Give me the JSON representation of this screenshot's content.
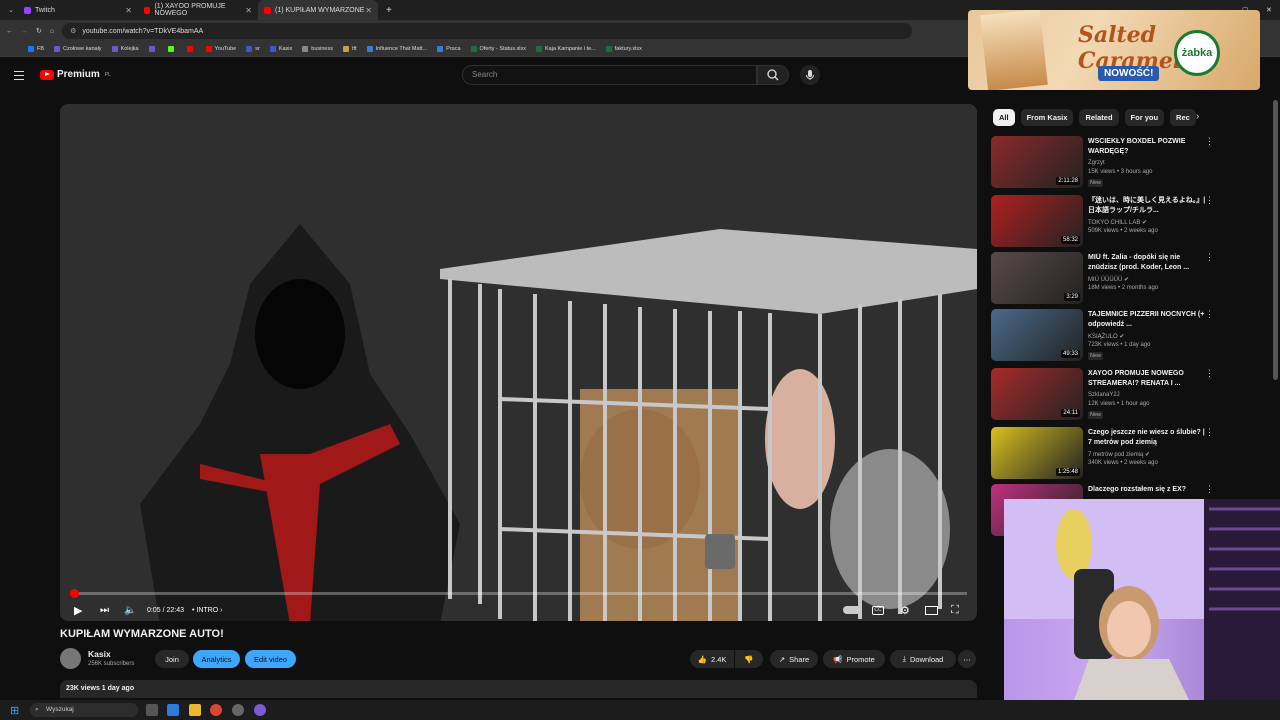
{
  "browser": {
    "tabs": [
      {
        "label": "Twitch",
        "color": "#9146ff"
      },
      {
        "label": "(1) XAYOO PROMUJE NOWEGO",
        "color": "#ff0000"
      },
      {
        "label": "(1) KUPIŁAM WYMARZONE",
        "color": "#ff0000",
        "active": true
      }
    ],
    "url": "youtube.com/watch?v=TDkVE4bamAA",
    "bookmarks": [
      {
        "label": "FB",
        "color": "#1877f2"
      },
      {
        "label": "Czołowe kanały",
        "color": "#6a5acd"
      },
      {
        "label": "Kolejka",
        "color": "#6a5acd"
      },
      {
        "label": "",
        "color": "#6a5acd"
      },
      {
        "label": "",
        "color": "#53fc18"
      },
      {
        "label": "",
        "color": "#ff0000"
      },
      {
        "label": "YouTube",
        "color": "#ff0000"
      },
      {
        "label": "sr",
        "color": "#4455cc"
      },
      {
        "label": "Kasix",
        "color": "#4455cc"
      },
      {
        "label": "business",
        "color": "#888888"
      },
      {
        "label": "tft",
        "color": "#c8a040"
      },
      {
        "label": "Influence That Matt...",
        "color": "#3a7bd5"
      },
      {
        "label": "Praca",
        "color": "#3a7bd5"
      },
      {
        "label": "Oferty - Status.xlsx",
        "color": "#1d6f42"
      },
      {
        "label": "Kaja Kampanie i te...",
        "color": "#1d6f42"
      },
      {
        "label": "faktury.xlsx",
        "color": "#1d6f42"
      }
    ]
  },
  "youtube": {
    "logo_text": "Premium",
    "logo_suffix": "PL",
    "search_placeholder": "Search"
  },
  "ad": {
    "title": "Salted Caramel",
    "badge": "NOWOŚĆ!",
    "brand": "żabka"
  },
  "player": {
    "progress_fraction": 0.004,
    "time": "0:05 / 22:43",
    "chapter": "INTRO"
  },
  "video": {
    "title": "KUPIŁAM WYMARZONE AUTO!",
    "channel": "Kasix",
    "subscribers": "256K subscribers",
    "join": "Join",
    "analytics": "Analytics",
    "edit": "Edit video",
    "likes": "2.4K",
    "share": "Share",
    "promote": "Promote",
    "download": "Download",
    "views_line": "23K views  1 day ago"
  },
  "sidebar": {
    "chips": [
      "All",
      "From Kasix",
      "Related",
      "For you",
      "Rec"
    ],
    "items": [
      {
        "title": "WŚCIEKŁY BOXDEL POZWIE WARDĘGĘ?",
        "channel": "Zgrzyt",
        "meta": "15K views • 3 hours ago",
        "badge": "New",
        "duration": "2:11:28",
        "bg": "#8a2a2a"
      },
      {
        "title": "『迷いは、時に美しく見えるよね。』| 日本語ラップ/チルラ...",
        "channel": "TOKYO CHILL LAB ✔",
        "meta": "509K views • 2 weeks ago",
        "badge": "",
        "duration": "58:32",
        "bg": "#b02020"
      },
      {
        "title": "MIÜ ft. Zalia - dopóki się nie znüdzisz (prod. Koder, Leon ...",
        "channel": "MIÜ ÜÜÜÜÜ ✔",
        "meta": "18M views • 2 months ago",
        "badge": "",
        "duration": "3:29",
        "bg": "#5a4a4a"
      },
      {
        "title": "TAJEMNICE PIZZERII NOCNYCH (+ odpowiedź ...",
        "channel": "KSIĄŻULO ✔",
        "meta": "723K views • 1 day ago",
        "badge": "New",
        "duration": "49:33",
        "bg": "#4a6a8a"
      },
      {
        "title": "XAYOO PROMUJE NOWEGO STREAMERA!? RENATA I ...",
        "channel": "SzklanaY2J",
        "meta": "12K views • 1 hour ago",
        "badge": "New",
        "duration": "24:11",
        "bg": "#a82a2a"
      },
      {
        "title": "Czego jeszcze nie wiesz o ślubie? | 7 metrów pod ziemią",
        "channel": "7 metrów pod ziemią ✔",
        "meta": "340K views • 2 weeks ago",
        "badge": "",
        "duration": "1:25:48",
        "bg": "#d8c020"
      },
      {
        "title": "Dlaczego rozstałem się z EX?",
        "channel": "",
        "meta": "",
        "badge": "",
        "duration": "",
        "bg": "#c03080"
      }
    ]
  },
  "taskbar": {
    "search_placeholder": "Wyszukaj"
  }
}
